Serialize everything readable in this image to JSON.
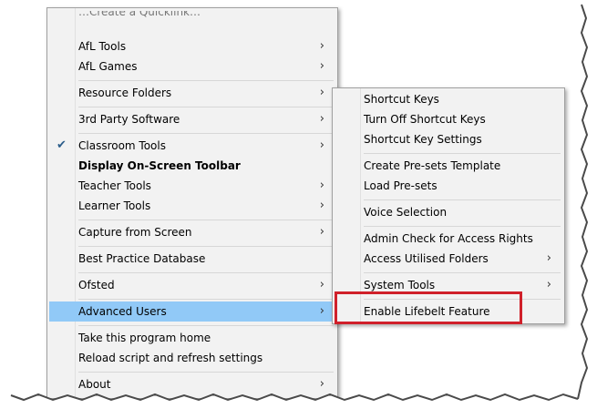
{
  "main_menu": {
    "cut_top_text": "…Create a Quicklink…",
    "items": [
      {
        "label": "AfL Tools",
        "arrow": "›"
      },
      {
        "label": "AfL Games",
        "arrow": "›"
      },
      {
        "label": "Resource Folders",
        "arrow": "›"
      },
      {
        "label": "3rd Party Software",
        "arrow": "›"
      },
      {
        "label": "Classroom Tools",
        "arrow": "›",
        "check": "✔"
      },
      {
        "label": "Display On-Screen Toolbar"
      },
      {
        "label": "Teacher Tools",
        "arrow": "›"
      },
      {
        "label": "Learner Tools",
        "arrow": "›"
      },
      {
        "label": "Capture from Screen",
        "arrow": "›"
      },
      {
        "label": "Best Practice Database"
      },
      {
        "label": "Ofsted",
        "arrow": "›"
      },
      {
        "label": "Advanced Users",
        "arrow": "›"
      },
      {
        "label": "Take this program home"
      },
      {
        "label": "Reload script and refresh settings"
      },
      {
        "label": "About",
        "arrow": "›"
      }
    ]
  },
  "sub_menu": {
    "items": [
      {
        "label": "Shortcut Keys"
      },
      {
        "label": "Turn Off Shortcut Keys"
      },
      {
        "label": "Shortcut Key Settings"
      },
      {
        "label": "Create Pre-sets Template"
      },
      {
        "label": "Load Pre-sets"
      },
      {
        "label": "Voice Selection"
      },
      {
        "label": "Admin Check for Access Rights"
      },
      {
        "label": "Access Utilised Folders",
        "arrow": "›"
      },
      {
        "label": "System Tools",
        "arrow": "›"
      },
      {
        "label": "Enable Lifebelt Feature"
      }
    ]
  },
  "colors": {
    "menu_bg": "#f2f2f2",
    "hover": "#91c9f7",
    "callout_border": "#d0202a"
  }
}
